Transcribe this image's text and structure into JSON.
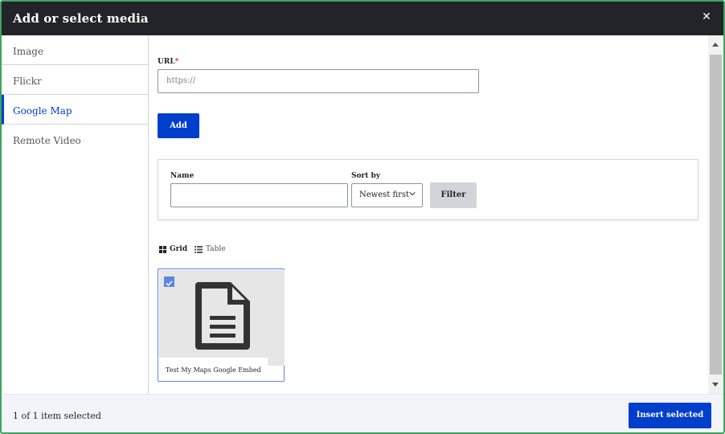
{
  "dialog": {
    "title": "Add or select media",
    "close_icon": "close-icon"
  },
  "sidebar": {
    "items": [
      {
        "label": "Image"
      },
      {
        "label": "Flickr"
      },
      {
        "label": "Google Map",
        "active": true
      },
      {
        "label": "Remote Video"
      }
    ]
  },
  "url_field": {
    "label": "URL",
    "required_marker": "*",
    "placeholder": "https://"
  },
  "add_button": "Add",
  "filters": {
    "name_label": "Name",
    "name_value": "",
    "sort_label": "Sort by",
    "sort_value": "Newest first",
    "filter_button": "Filter"
  },
  "view_toggle": {
    "grid_label": "Grid",
    "table_label": "Table",
    "active": "Grid"
  },
  "media_items": [
    {
      "name": "Test My Maps Google Embed",
      "selected": true,
      "icon": "document-icon"
    }
  ],
  "footer": {
    "selection_count": "1 of 1 item selected",
    "insert_button": "Insert selected"
  },
  "colors": {
    "accent": "#003ecc",
    "titlebar": "#232429",
    "selection": "#5a86e6",
    "dialog_border": "#3fa460"
  }
}
